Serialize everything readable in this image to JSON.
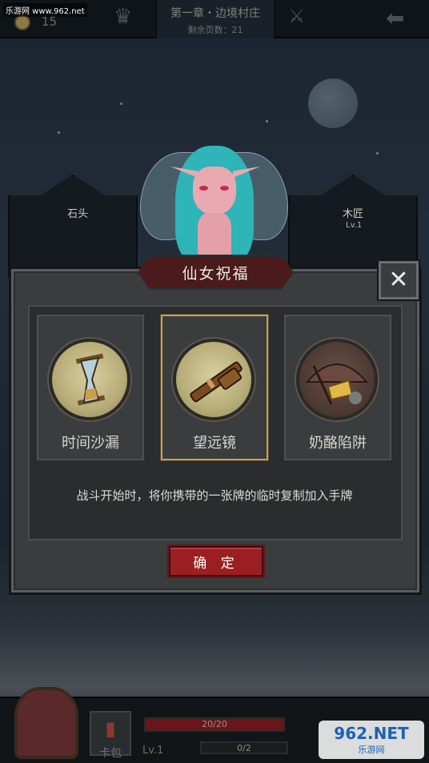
{
  "watermark_top": "乐游网 www.962.net",
  "topbar": {
    "coin_count": "15",
    "chapter_title": "第一章・边境村庄",
    "pages_left": "剩余页数：21"
  },
  "buildings": {
    "left_name": "石头",
    "right_name": "木匠",
    "right_level": "Lv.1"
  },
  "dialog": {
    "title": "仙女祝福",
    "cards": [
      {
        "label": "时间沙漏",
        "icon": "hourglass-icon",
        "selected": false
      },
      {
        "label": "望远镜",
        "icon": "telescope-icon",
        "selected": true
      },
      {
        "label": "奶酪陷阱",
        "icon": "cheese-trap-icon",
        "selected": false
      }
    ],
    "description": "战斗开始时，将你携带的一张牌的临时复制加入手牌",
    "confirm_label": "确 定"
  },
  "bottom": {
    "deck_label": "卡包",
    "level_label": "Lv.1",
    "hp_text": "20/20",
    "hp_fraction": 1.0,
    "xp_text": "0/2"
  },
  "watermark_bottom": {
    "big": "962.NET",
    "small": "乐游网"
  },
  "colors": {
    "accent_red": "#9b1f22",
    "selected_border": "#c7a25e"
  }
}
